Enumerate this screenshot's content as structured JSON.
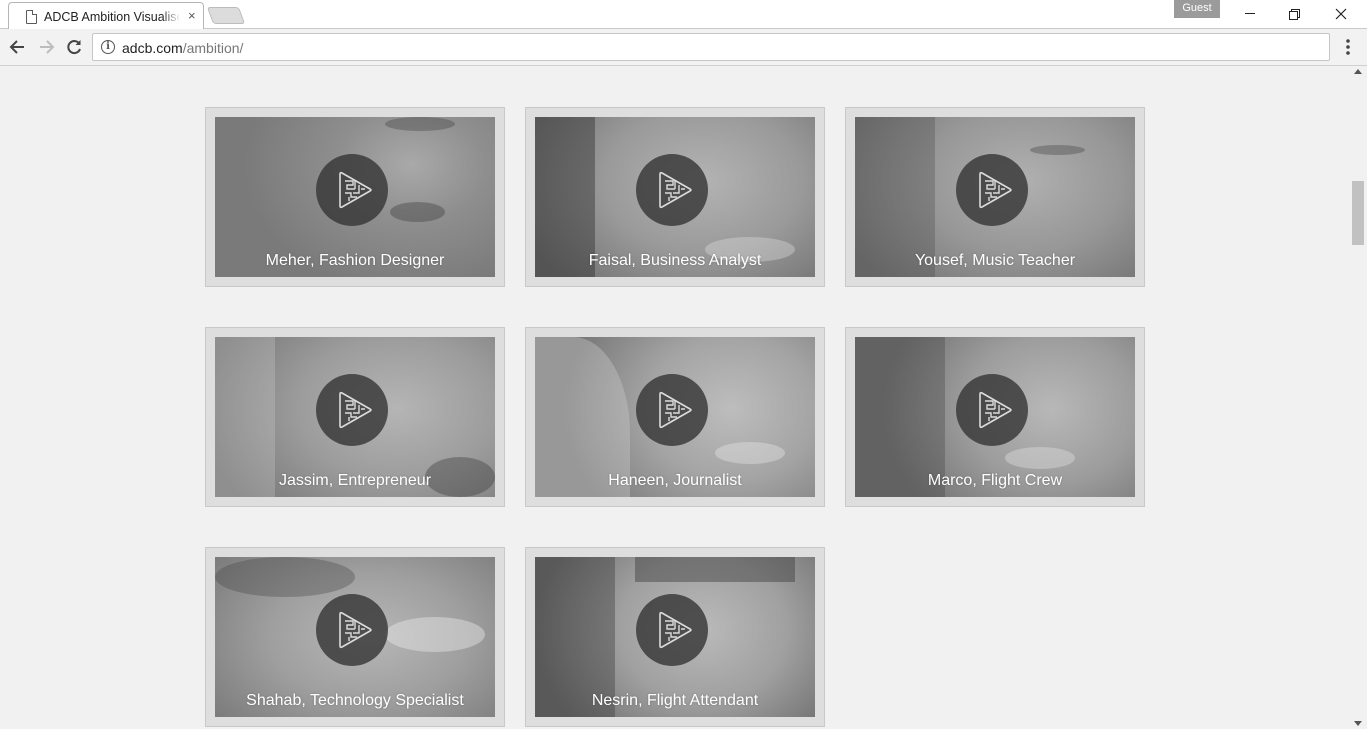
{
  "browser": {
    "tab_title": "ADCB Ambition Visualise",
    "tab_close": "×",
    "profile_label": "Guest",
    "url_host": "adcb.com",
    "url_path": "/ambition/",
    "icons": {
      "back": "arrow-left-icon",
      "forward": "arrow-right-icon",
      "reload": "reload-icon",
      "info": "info-icon",
      "menu": "kebab-menu-icon",
      "page": "page-icon"
    }
  },
  "gallery": {
    "items": [
      {
        "caption": "Meher, Fashion Designer"
      },
      {
        "caption": "Faisal, Business Analyst"
      },
      {
        "caption": "Yousef, Music Teacher"
      },
      {
        "caption": "Jassim, Entrepreneur"
      },
      {
        "caption": "Haneen, Journalist"
      },
      {
        "caption": "Marco, Flight Crew"
      },
      {
        "caption": "Shahab, Technology Specialist"
      },
      {
        "caption": "Nesrin, Flight Attendant"
      }
    ],
    "play_icon": "maze-play-icon",
    "colors": {
      "page_background": "#f1f1f1",
      "card_background": "#dedede",
      "play_circle": "#373737",
      "caption_text": "#ffffff"
    }
  }
}
